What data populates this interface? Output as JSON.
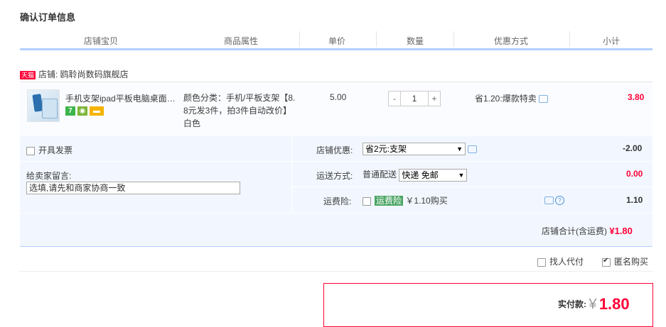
{
  "page_title": "确认订单信息",
  "columns": [
    "店铺宝贝",
    "商品属性",
    "单价",
    "数量",
    "优惠方式",
    "小计"
  ],
  "shop": {
    "badge": "天猫",
    "label": "店铺: 鸥聆尚数码旗舰店"
  },
  "item": {
    "title": "手机支架ipad平板电脑桌面…",
    "attrs_line1": "颜色分类：手机/平板支架【8.",
    "attrs_line2": "8元发3件，拍3件自动改价】",
    "attrs_line3": "白色",
    "unit_price": "5.00",
    "quantity": "1",
    "qty_minus": "-",
    "qty_plus": "+",
    "discount": "省1.20:爆款特卖",
    "subtotal": "3.80",
    "icons": [
      "七天退换-icon",
      "消保-icon",
      "信用卡-icon"
    ]
  },
  "options": {
    "invoice_label": "开具发票",
    "message_label": "给卖家留言:",
    "message_value": "选填,请先和商家协商一致",
    "store_discount_label": "店铺优惠:",
    "store_discount_value": "省2元:支架",
    "store_discount_amount": "-2.00",
    "shipping_label": "运送方式:",
    "shipping_prefix": "普通配送",
    "shipping_value": "快递 免邮",
    "shipping_amount": "0.00",
    "insurance_label": "运费险:",
    "insurance_tag": "运费险",
    "insurance_price": "￥1.10购买",
    "insurance_amount": "1.10",
    "store_total_label": "店铺合计(含运费)",
    "store_total_value": "¥1.80"
  },
  "extras": {
    "proxy_pay": "找人代付",
    "anonymous": "匿名购买"
  },
  "payment": {
    "label": "实付款:",
    "currency": "¥",
    "amount": "1.80"
  },
  "colors": {
    "accent_red": "#ff0036",
    "header_line": "#b2d1ff",
    "panel_bg": "#f2f7ff"
  }
}
